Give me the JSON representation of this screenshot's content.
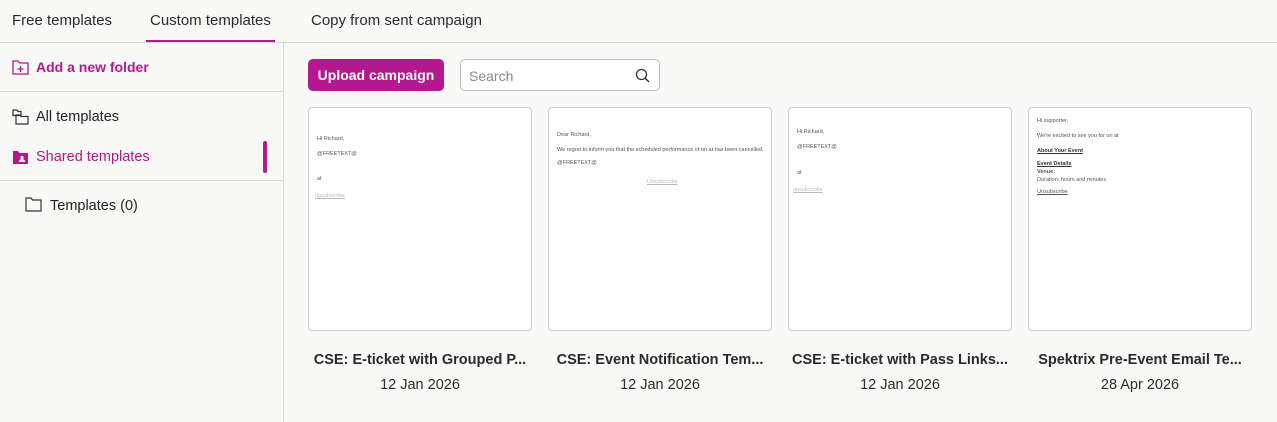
{
  "tabs": [
    {
      "label": "Free templates"
    },
    {
      "label": "Custom templates"
    },
    {
      "label": "Copy from sent campaign"
    }
  ],
  "sidebar": {
    "add_folder": "Add a new folder",
    "all_templates": "All templates",
    "shared_templates": "Shared templates",
    "folder": "Templates (0)"
  },
  "toolbar": {
    "upload_label": "Upload campaign",
    "search_placeholder": "Search"
  },
  "colors": {
    "accent": "#b5178f"
  },
  "cards": [
    {
      "title": "CSE: E-ticket with Grouped P...",
      "date": "12 Jan 2026",
      "preview": [
        "Hi Richard,",
        "@FREETEXT@",
        "at",
        "unsubscribe"
      ]
    },
    {
      "title": "CSE: Event Notification Tem...",
      "date": "12 Jan 2026",
      "preview": [
        "Dear Richard,",
        "We regret to inform you that the scheduled performance of on at has been cancelled.",
        "@FREETEXT@",
        "Unsubscribe"
      ]
    },
    {
      "title": "CSE: E-ticket with Pass Links...",
      "date": "12 Jan 2026",
      "preview": [
        "Hi Richard,",
        "@FREETEXT@",
        "at",
        "unsubscribe"
      ]
    },
    {
      "title": "Spektrix Pre-Event Email Te...",
      "date": "28 Apr 2026",
      "preview": [
        "Hi supporter,",
        "We're excited to see you for on at",
        "About Your Event",
        "Event Details",
        "Venue:",
        "Duration: hours and minutes",
        "Unsubscribe"
      ]
    }
  ]
}
